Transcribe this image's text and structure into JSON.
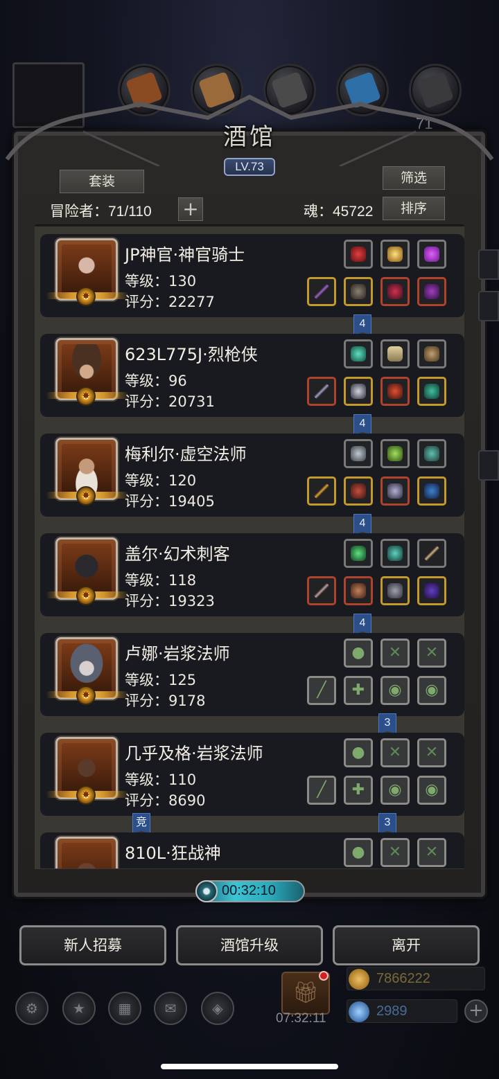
{
  "header": {
    "title": "酒馆",
    "level": "LV.73",
    "suit_button": "套装",
    "filter_button": "筛选",
    "sort_button": "排序",
    "adventurers": "冒险者：71/110",
    "add_label": "+",
    "soul": "魂：45722",
    "top_count": "71"
  },
  "heroes": [
    {
      "name": "JP神官·神官骑士",
      "level": "等级：130",
      "score": "评分：22277",
      "link": "4"
    },
    {
      "name": "623L775J·烈枪侠",
      "level": "等级：96",
      "score": "评分：20731",
      "link": "4"
    },
    {
      "name": "梅利尔·虚空法师",
      "level": "等级：120",
      "score": "评分：19405",
      "link": "4"
    },
    {
      "name": "盖尔·幻术刺客",
      "level": "等级：118",
      "score": "评分：19323",
      "link": "4"
    },
    {
      "name": "卢娜·岩浆法师",
      "level": "等级：125",
      "score": "评分：9178",
      "link": "3"
    },
    {
      "name": "几乎及格·岩浆法师",
      "level": "等级：110",
      "score": "评分：8690",
      "link": "3",
      "tag": "竞"
    },
    {
      "name": "810L·狂战神",
      "level": "",
      "score": ""
    }
  ],
  "timer": "00:32:10",
  "actions": {
    "recruit": "新人招募",
    "upgrade": "酒馆升级",
    "leave": "离开"
  },
  "dock": {
    "gift_timer": "07:32:11",
    "gold": "7866222",
    "gems": "2989",
    "add_label": "+"
  },
  "colors": {
    "accent_blue": "#2c4f8a",
    "gold_frame": "#c49b2a",
    "red_frame": "#b0432a",
    "timer_cyan": "#3dc3d4"
  }
}
